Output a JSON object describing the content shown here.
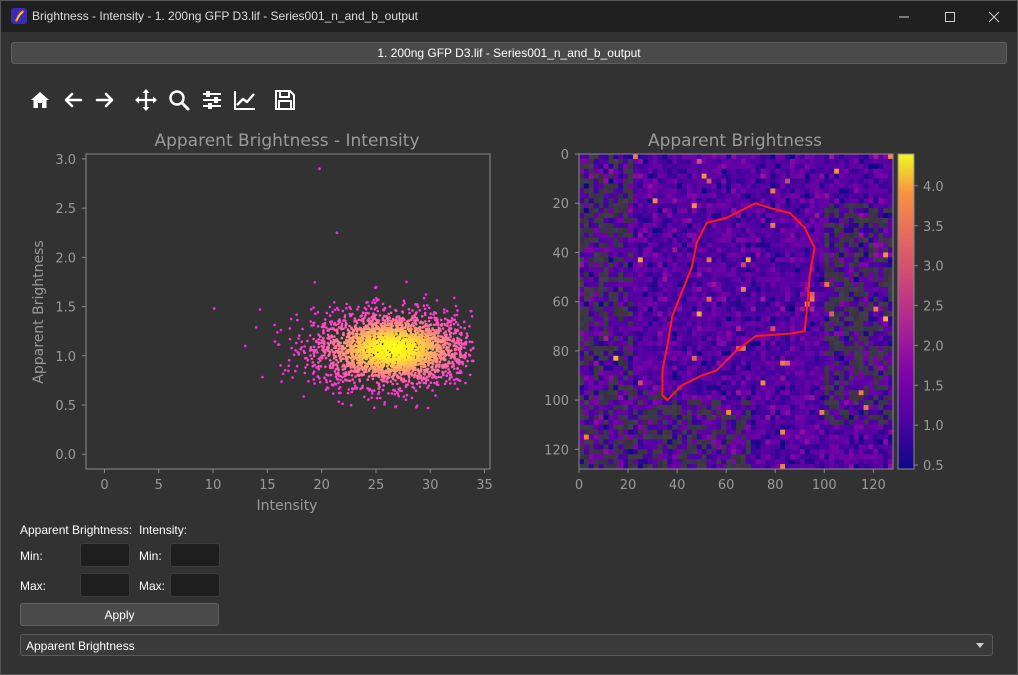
{
  "window": {
    "title": "Brightness - Intensity - 1. 200ng GFP D3.lif - Series001_n_and_b_output",
    "minimize_icon": "minimize-icon",
    "maximize_icon": "maximize-icon",
    "close_icon": "close-icon"
  },
  "header": {
    "label": "1. 200ng GFP D3.lif - Series001_n_and_b_output"
  },
  "toolbar": {
    "buttons": [
      "home-icon",
      "back-arrow-icon",
      "forward-arrow-icon",
      "pan-icon",
      "zoom-icon",
      "configure-subplots-icon",
      "edit-axes-icon",
      "save-icon"
    ]
  },
  "colors": {
    "axis_text": "#9a9a9a",
    "roi": "#ff1a1a",
    "plot_bg": "#323232"
  },
  "chart_data": [
    {
      "type": "scatter",
      "title": "Apparent Brightness - Intensity",
      "xlabel": "Intensity",
      "ylabel": "Apparent Brightness",
      "xlim": [
        -1.7,
        35.5
      ],
      "ylim": [
        -0.15,
        3.05
      ],
      "xticks": [
        "0",
        "5",
        "10",
        "15",
        "20",
        "25",
        "30",
        "35"
      ],
      "yticks": [
        "0.0",
        "0.5",
        "1.0",
        "1.5",
        "2.0",
        "2.5",
        "3.0"
      ],
      "colormap": "spring-to-yellow density",
      "cluster": {
        "center_x": 26.5,
        "center_y": 1.07,
        "x_range": [
          10,
          34
        ],
        "y_range": [
          0.47,
          1.95
        ],
        "approx_points": 3000
      },
      "outliers": [
        {
          "x": 19.8,
          "y": 2.9
        },
        {
          "x": 21.4,
          "y": 2.25
        },
        {
          "x": 10.1,
          "y": 1.48
        },
        {
          "x": 26.8,
          "y": 0.48
        },
        {
          "x": 29.8,
          "y": 0.47
        }
      ]
    },
    {
      "type": "heatmap",
      "title": "Apparent Brightness",
      "xticks": [
        "0",
        "20",
        "40",
        "60",
        "80",
        "100",
        "120"
      ],
      "yticks": [
        "0",
        "20",
        "40",
        "60",
        "80",
        "100",
        "120"
      ],
      "xlim": [
        0,
        128
      ],
      "ylim": [
        128,
        0
      ],
      "colorbar": {
        "min": 0.45,
        "max": 4.4,
        "ticks": [
          "0.5",
          "1.0",
          "1.5",
          "2.0",
          "2.5",
          "3.0",
          "3.5",
          "4.0"
        ],
        "colormap": "plasma"
      },
      "roi_outline": [
        [
          72,
          20
        ],
        [
          78,
          22
        ],
        [
          86,
          24
        ],
        [
          92,
          30
        ],
        [
          96,
          38
        ],
        [
          94,
          50
        ],
        [
          93,
          62
        ],
        [
          92,
          72
        ],
        [
          86,
          73
        ],
        [
          72,
          74
        ],
        [
          64,
          80
        ],
        [
          56,
          88
        ],
        [
          50,
          90
        ],
        [
          42,
          94
        ],
        [
          36,
          100
        ],
        [
          34,
          98
        ],
        [
          34,
          88
        ],
        [
          36,
          78
        ],
        [
          38,
          66
        ],
        [
          42,
          56
        ],
        [
          46,
          46
        ],
        [
          48,
          36
        ],
        [
          52,
          28
        ],
        [
          60,
          26
        ],
        [
          68,
          22
        ]
      ]
    }
  ],
  "controls": {
    "apparent_brightness_label": "Apparent Brightness:",
    "intensity_label": "Intensity:",
    "min_label": "Min:",
    "max_label": "Max:",
    "ab_min_value": "",
    "ab_max_value": "",
    "int_min_value": "",
    "int_max_value": "",
    "apply_label": "Apply",
    "dropdown_value": "Apparent Brightness"
  }
}
